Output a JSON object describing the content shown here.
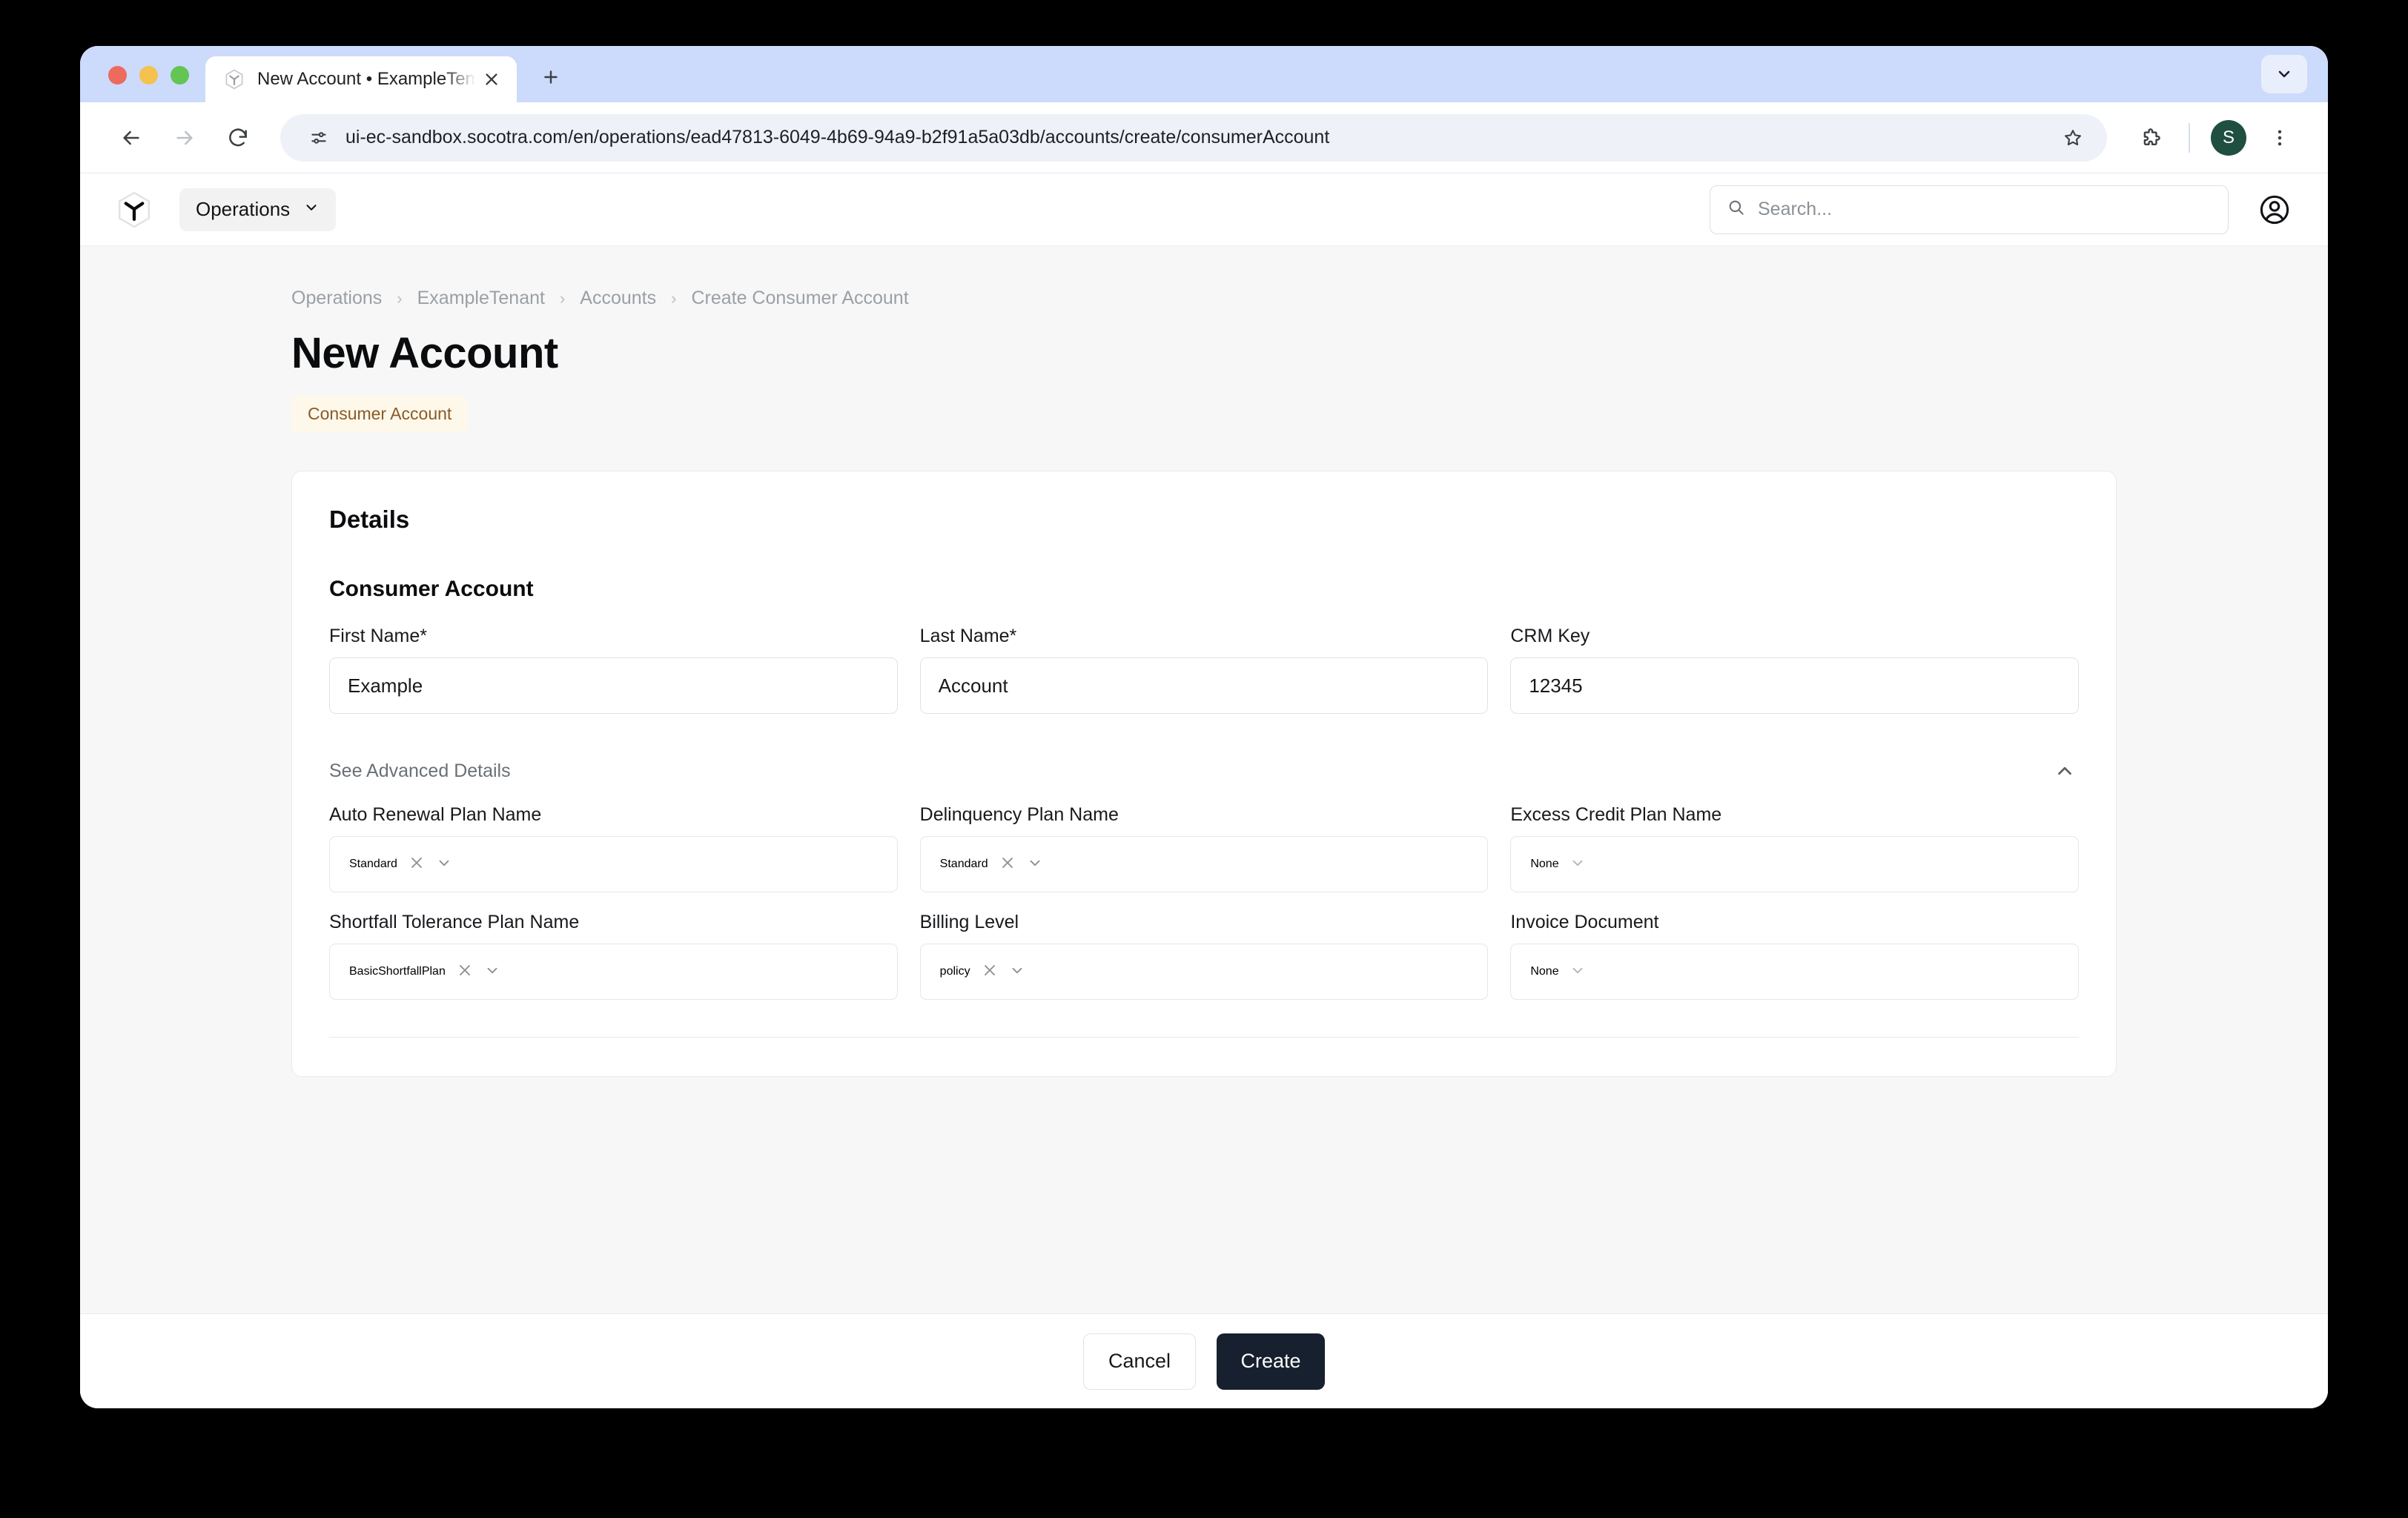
{
  "browser": {
    "tab": {
      "title": "New Account • ExampleTenant",
      "favicon_icon": "socotra-hexagon-icon",
      "close_icon": "close-icon"
    },
    "new_tab_icon": "plus-icon",
    "tabstrip_menu_icon": "chevron-down-icon",
    "toolbar": {
      "back_icon": "arrow-left-icon",
      "forward_icon": "arrow-right-icon",
      "reload_icon": "reload-icon",
      "site_info_icon": "tune-icon",
      "url": "ui-ec-sandbox.socotra.com/en/operations/ead47813-6049-4b69-94a9-b2f91a5a03db/accounts/create/consumerAccount",
      "bookmark_icon": "star-icon",
      "extensions_icon": "puzzle-icon",
      "profile_initial": "S",
      "profile_color": "#1f4f41",
      "menu_icon": "kebab-menu-icon"
    }
  },
  "app_header": {
    "logo_icon": "socotra-hexagon-icon",
    "switcher_label": "Operations",
    "switcher_chevron_icon": "chevron-down-icon",
    "search_placeholder": "Search...",
    "search_icon": "search-icon",
    "account_icon": "user-circle-icon"
  },
  "breadcrumb": [
    {
      "label": "Operations"
    },
    {
      "label": "ExampleTenant"
    },
    {
      "label": "Accounts"
    },
    {
      "label": "Create Consumer Account"
    }
  ],
  "page": {
    "title": "New Account",
    "badge": "Consumer Account",
    "badge_bg": "#fdf8e9",
    "badge_fg": "#8a5a2b"
  },
  "card": {
    "title": "Details",
    "section_title": "Consumer Account",
    "basic_fields": [
      {
        "label": "First Name*",
        "value": "Example",
        "type": "text"
      },
      {
        "label": "Last Name*",
        "value": "Account",
        "type": "text"
      },
      {
        "label": "CRM Key",
        "value": "12345",
        "type": "text"
      }
    ],
    "advanced_toggle": {
      "label": "See Advanced Details",
      "chevron_icon": "chevron-up-icon",
      "expanded": true
    },
    "advanced_fields_row1": [
      {
        "label": "Auto Renewal Plan Name",
        "value": "Standard",
        "empty": false,
        "clear_icon": "clear-x-icon",
        "chevron_icon": "chevron-down-icon"
      },
      {
        "label": "Delinquency Plan Name",
        "value": "Standard",
        "empty": false,
        "clear_icon": "clear-x-icon",
        "chevron_icon": "chevron-down-icon"
      },
      {
        "label": "Excess Credit Plan Name",
        "value": "None",
        "empty": true,
        "clear_icon": "",
        "chevron_icon": "chevron-down-icon"
      }
    ],
    "advanced_fields_row2": [
      {
        "label": "Shortfall Tolerance Plan Name",
        "value": "BasicShortfallPlan",
        "empty": false,
        "clear_icon": "clear-x-icon",
        "chevron_icon": "chevron-down-icon"
      },
      {
        "label": "Billing Level",
        "value": "policy",
        "empty": false,
        "clear_icon": "clear-x-icon",
        "chevron_icon": "chevron-down-icon"
      },
      {
        "label": "Invoice Document",
        "value": "None",
        "empty": true,
        "clear_icon": "",
        "chevron_icon": "chevron-down-icon"
      }
    ]
  },
  "footer": {
    "cancel_label": "Cancel",
    "create_label": "Create",
    "create_bg": "#16202e"
  }
}
